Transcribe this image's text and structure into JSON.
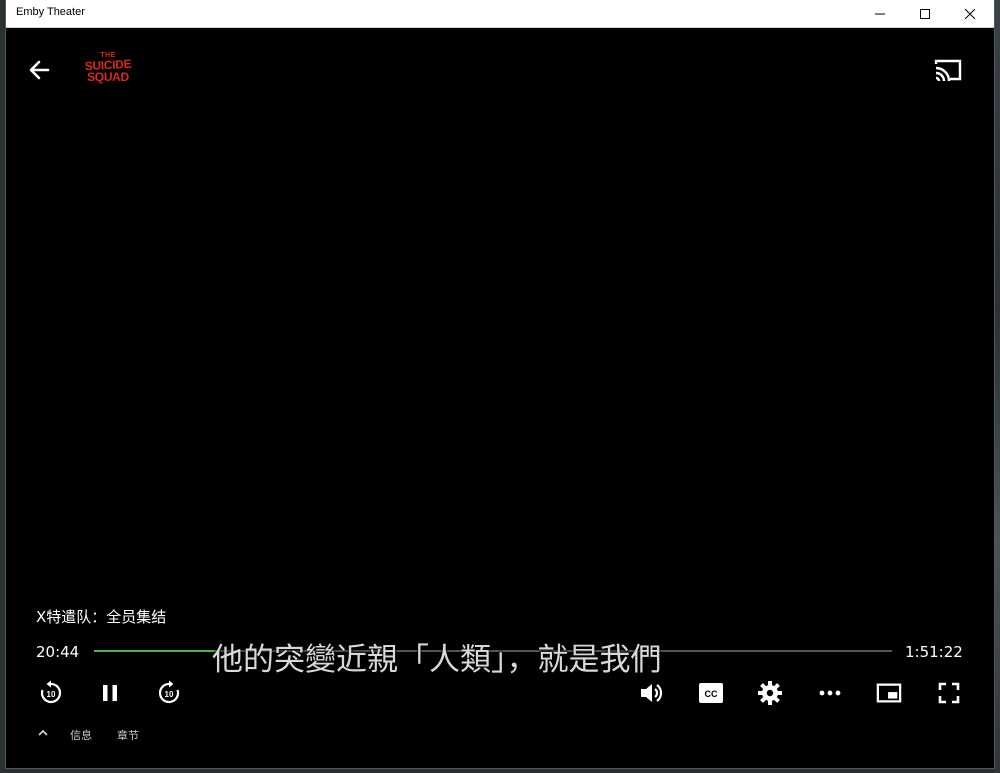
{
  "window": {
    "title": "Emby Theater"
  },
  "media": {
    "logo": {
      "line1": "THE",
      "line2": "SUICIDE",
      "line3": "SQUAD"
    },
    "title": "X特遣队：全员集结",
    "subtitle": "他的突變近親「人類」，就是我們",
    "current_time": "20:44",
    "total_time": "1:51:22",
    "progress": 0.155
  },
  "colors": {
    "accent": "#52b54b",
    "logo": "#d9281f",
    "background": "#000000"
  },
  "controls": {
    "skip_back_seconds": "10",
    "skip_forward_seconds": "10",
    "cc_label": "CC"
  },
  "tabs": {
    "info": "信息",
    "chapters": "章节"
  },
  "icons": [
    "back-arrow-icon",
    "cast-icon",
    "replay-10-icon",
    "pause-icon",
    "forward-10-icon",
    "volume-icon",
    "closed-captions-icon",
    "gear-icon",
    "more-icon",
    "picture-in-picture-icon",
    "fullscreen-icon",
    "chevron-up-icon"
  ]
}
